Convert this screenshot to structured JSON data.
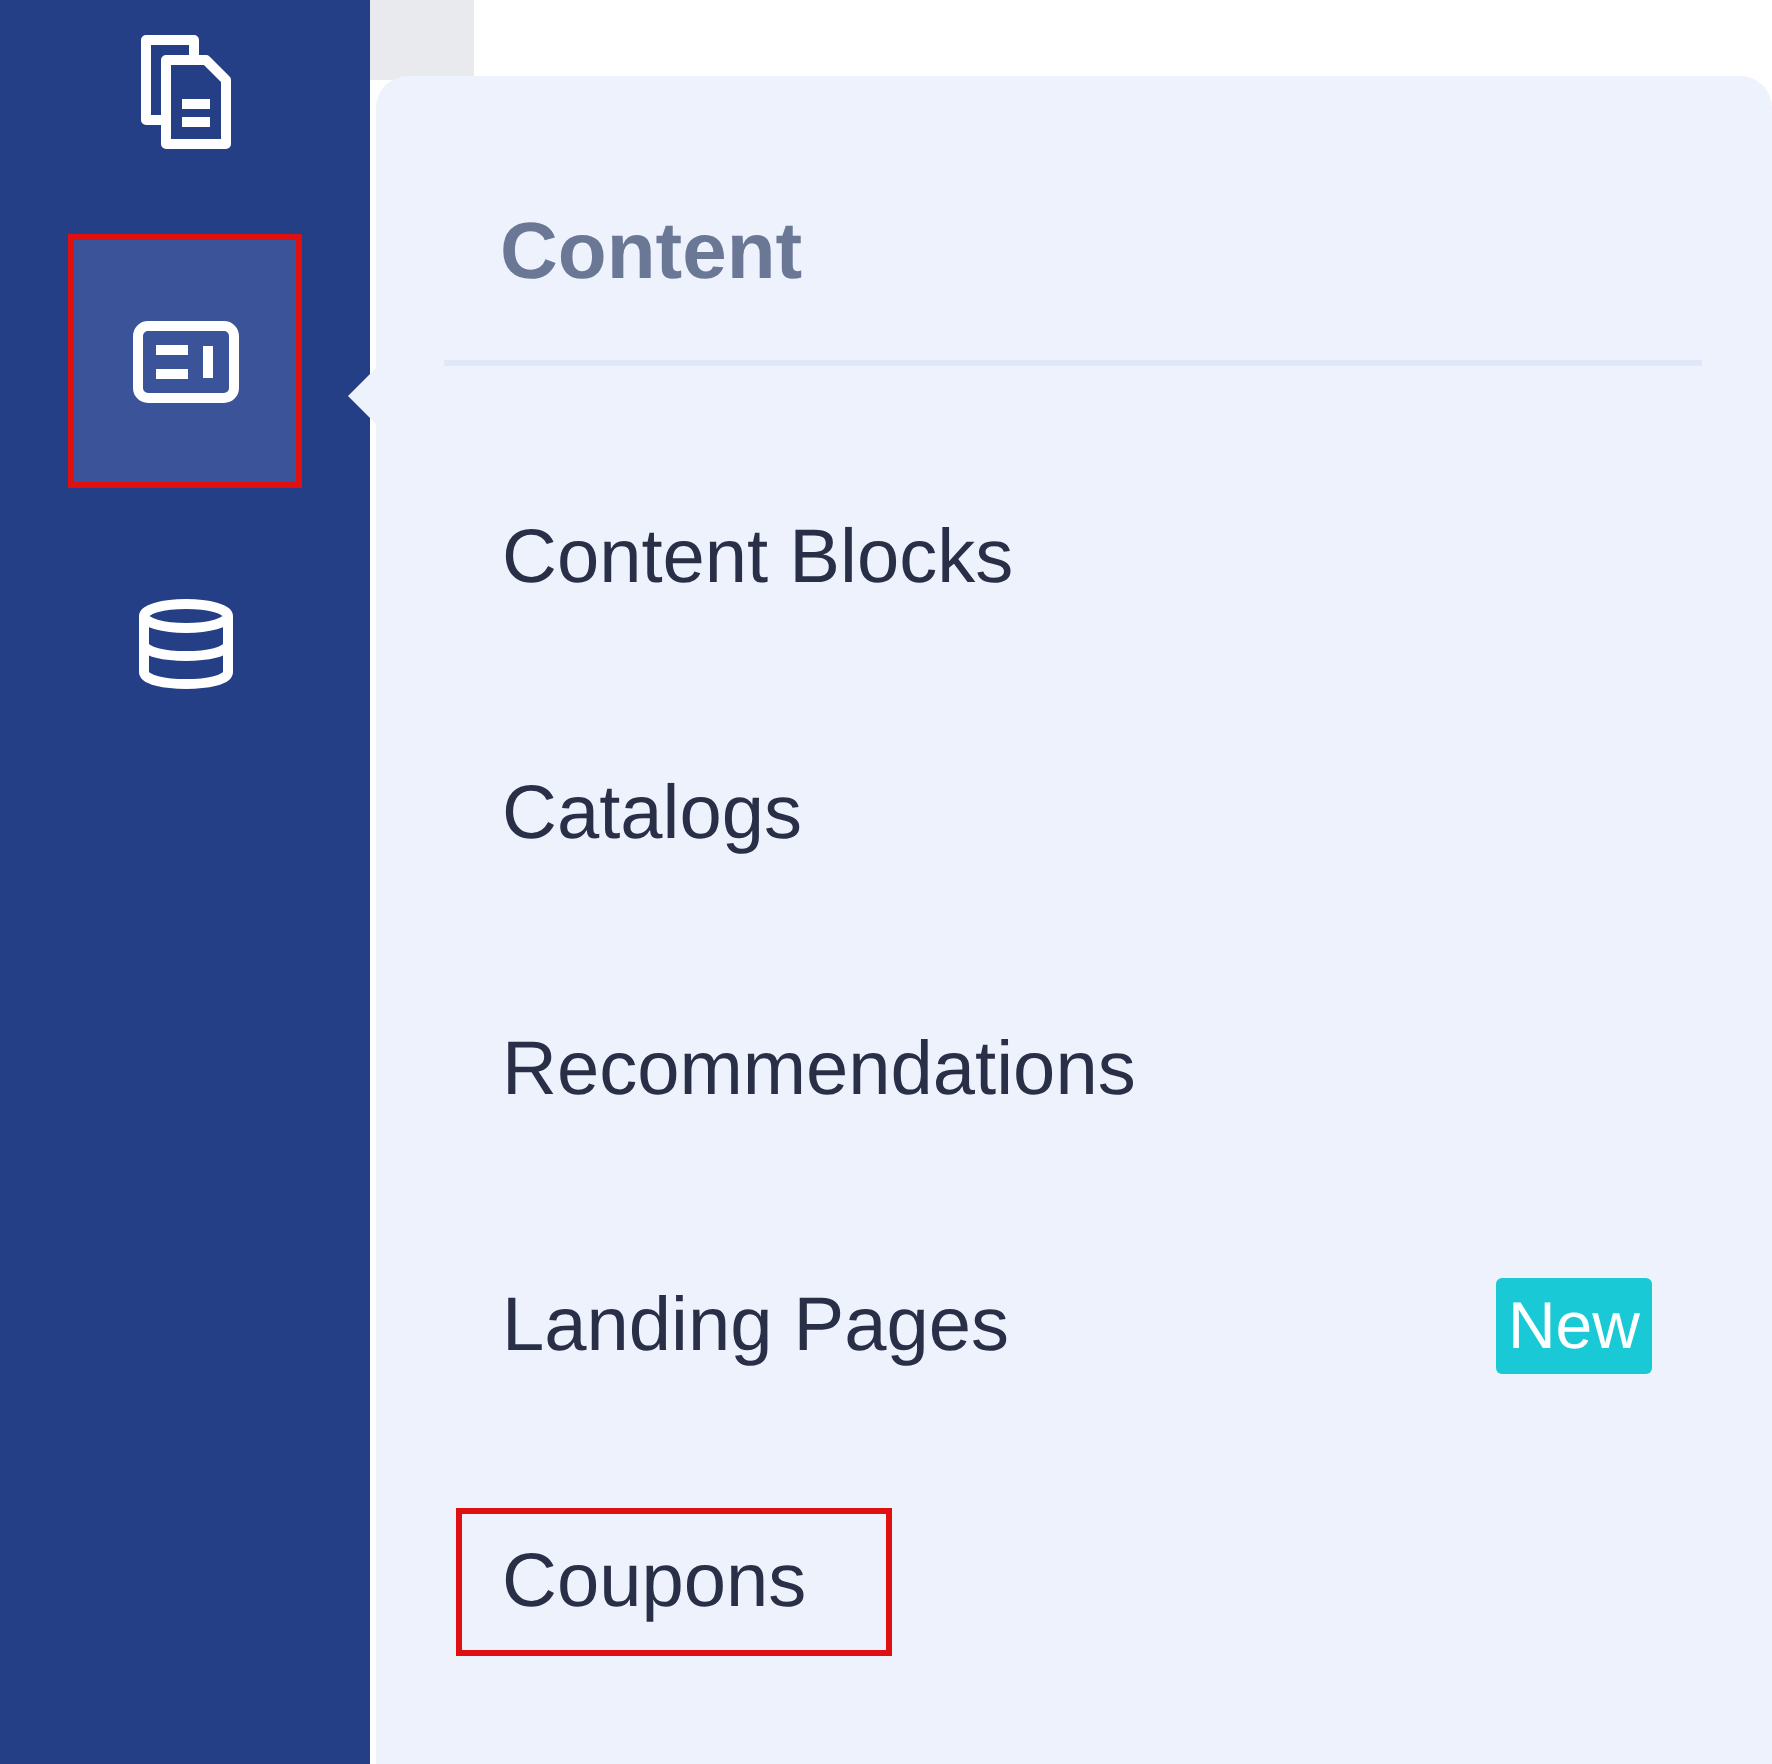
{
  "sidebar": {
    "items": [
      {
        "kind": "documents",
        "selected": false,
        "highlighted": false
      },
      {
        "kind": "content",
        "selected": true,
        "highlighted": true
      },
      {
        "kind": "database",
        "selected": false,
        "highlighted": false
      }
    ]
  },
  "menu": {
    "title": "Content",
    "items": [
      {
        "label": "Content Blocks",
        "highlighted": false
      },
      {
        "label": "Catalogs",
        "highlighted": false
      },
      {
        "label": "Recommendations",
        "highlighted": false
      },
      {
        "label": "Landing Pages",
        "badge": "New",
        "highlighted": false
      },
      {
        "label": "Coupons",
        "highlighted": true
      }
    ]
  }
}
